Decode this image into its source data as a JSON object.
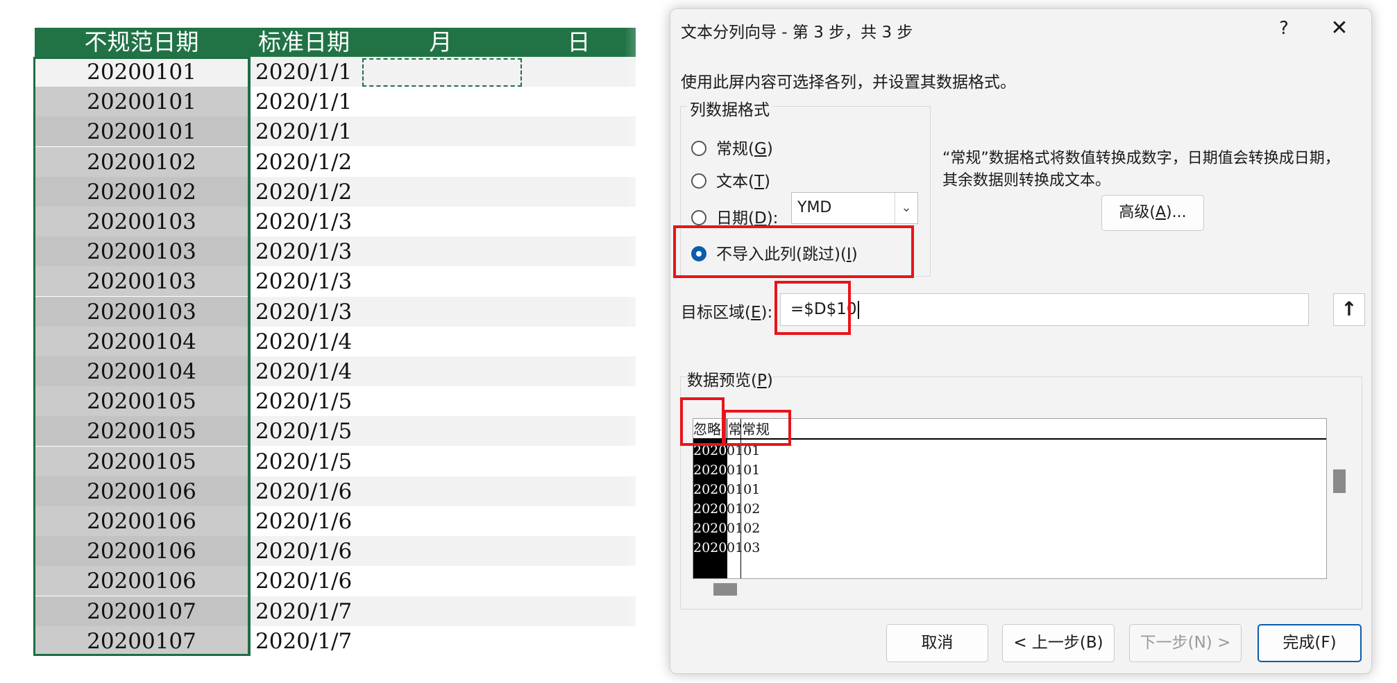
{
  "sheet": {
    "headers": [
      "不规范日期",
      "标准日期",
      "月",
      "日"
    ],
    "rows": [
      {
        "a": "20200101",
        "b": "2020/1/1"
      },
      {
        "a": "20200101",
        "b": "2020/1/1"
      },
      {
        "a": "20200101",
        "b": "2020/1/1"
      },
      {
        "a": "20200102",
        "b": "2020/1/2"
      },
      {
        "a": "20200102",
        "b": "2020/1/2"
      },
      {
        "a": "20200103",
        "b": "2020/1/3"
      },
      {
        "a": "20200103",
        "b": "2020/1/3"
      },
      {
        "a": "20200103",
        "b": "2020/1/3"
      },
      {
        "a": "20200103",
        "b": "2020/1/3"
      },
      {
        "a": "20200104",
        "b": "2020/1/4"
      },
      {
        "a": "20200104",
        "b": "2020/1/4"
      },
      {
        "a": "20200105",
        "b": "2020/1/5"
      },
      {
        "a": "20200105",
        "b": "2020/1/5"
      },
      {
        "a": "20200105",
        "b": "2020/1/5"
      },
      {
        "a": "20200106",
        "b": "2020/1/6"
      },
      {
        "a": "20200106",
        "b": "2020/1/6"
      },
      {
        "a": "20200106",
        "b": "2020/1/6"
      },
      {
        "a": "20200106",
        "b": "2020/1/6"
      },
      {
        "a": "20200107",
        "b": "2020/1/7"
      },
      {
        "a": "20200107",
        "b": "2020/1/7"
      }
    ]
  },
  "dialog": {
    "title": "文本分列向导 - 第 3 步，共 3 步",
    "help_label": "?",
    "close_label": "✕",
    "description": "使用此屏内容可选择各列，并设置其数据格式。",
    "group_label": "列数据格式",
    "radios": [
      {
        "text": "常规(",
        "key": "G",
        "end": ")",
        "checked": false
      },
      {
        "text": "文本(",
        "key": "T",
        "end": ")",
        "checked": false
      },
      {
        "text": "日期(",
        "key": "D",
        "end": "):",
        "checked": false
      },
      {
        "text": "不导入此列(跳过)(",
        "key": "I",
        "end": ")",
        "checked": true
      }
    ],
    "date_format": "YMD",
    "format_description": "“常规”数据格式将数值转换成数字，日期值会转换成日期，其余数据则转换成文本。",
    "advanced_text": "高级(",
    "advanced_key": "A",
    "advanced_end": ")...",
    "destination_text": "目标区域(",
    "destination_key": "E",
    "destination_end": "):",
    "destination_value": "=$D$10",
    "collapse_label": "↑",
    "preview_text": "数据预览(",
    "preview_key": "P",
    "preview_end": ")",
    "preview_headers": [
      "忽略",
      "常",
      "常规"
    ],
    "preview_rows": [
      {
        "skip": "2020",
        "rest": "0101"
      },
      {
        "skip": "2020",
        "rest": "0101"
      },
      {
        "skip": "2020",
        "rest": "0101"
      },
      {
        "skip": "2020",
        "rest": "0102"
      },
      {
        "skip": "2020",
        "rest": "0102"
      },
      {
        "skip": "2020",
        "rest": "0103"
      }
    ],
    "buttons": {
      "cancel": "取消",
      "back": "< 上一步(B)",
      "next": "下一步(N) >",
      "finish": "完成(F)"
    }
  },
  "colors": {
    "header_green": "#217346",
    "selection_green": "#1e6e43",
    "highlight_red": "#e8141a",
    "accent_blue": "#0b5cad"
  }
}
